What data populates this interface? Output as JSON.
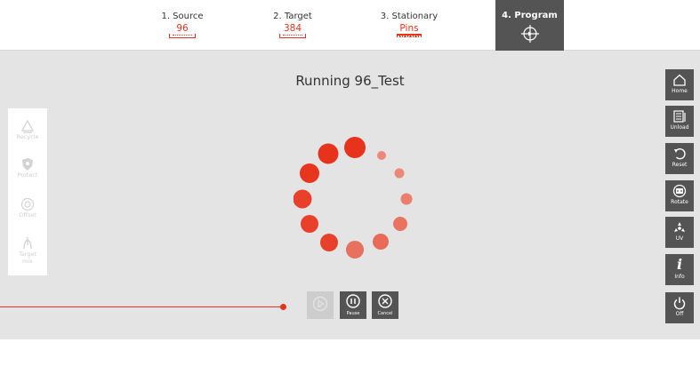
{
  "steps": [
    {
      "label": "1. Source",
      "value": "96"
    },
    {
      "label": "2. Target",
      "value": "384"
    },
    {
      "label": "3. Stationary",
      "value": "Pins"
    },
    {
      "label": "4. Program",
      "icon": "crosshair-icon"
    }
  ],
  "main": {
    "title": "Running 96_Test"
  },
  "left_tools": [
    {
      "label": "Recycle",
      "icon": "recycle-icon"
    },
    {
      "label": "Protect",
      "icon": "shield-icon"
    },
    {
      "label": "Offset",
      "icon": "target-icon"
    },
    {
      "label": "Target\nmix",
      "icon": "mix-icon"
    }
  ],
  "controls": {
    "play": {
      "label": "",
      "icon": "play-icon"
    },
    "pause": {
      "label": "Pause",
      "icon": "pause-icon"
    },
    "cancel": {
      "label": "Cancel",
      "icon": "cancel-icon"
    }
  },
  "right_buttons": [
    {
      "label": "Home",
      "icon": "home-icon"
    },
    {
      "label": "Unload",
      "icon": "unload-icon"
    },
    {
      "label": "Reset",
      "icon": "reset-icon"
    },
    {
      "label": "Rotate",
      "icon": "rotate-icon"
    },
    {
      "label": "UV",
      "icon": "uv-icon"
    },
    {
      "label": "Info",
      "icon": "info-icon"
    },
    {
      "label": "Off",
      "icon": "power-icon"
    }
  ],
  "colors": {
    "accent": "#e8331c",
    "dark": "#545454",
    "background": "#e4e4e4"
  }
}
